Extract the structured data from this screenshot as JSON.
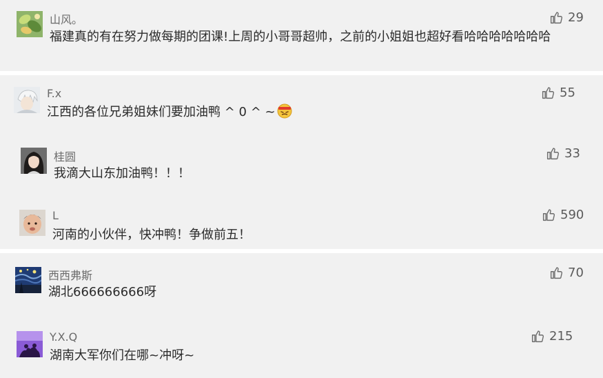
{
  "comments": [
    {
      "name": "山风。",
      "text": "福建真的有在努力做每期的团课!上周的小哥哥超帅，之前的小姐姐也超好看哈哈哈哈哈哈哈",
      "likes": "29",
      "avatar_icon": "green-leaves-avatar"
    },
    {
      "name": "F.x",
      "text": "江西的各位兄弟姐妹们要加油鸭 ^ 0 ^ ~",
      "likes": "55",
      "avatar_icon": "anime-character-avatar",
      "emoji_icon": "determined-face-emoji"
    },
    {
      "name": "桂圆",
      "text": "我滴大山东加油鸭！！！",
      "likes": "33",
      "avatar_icon": "girl-portrait-avatar"
    },
    {
      "name": "L",
      "text": "河南的小伙伴，快冲鸭！争做前五！",
      "likes": "590",
      "avatar_icon": "child-portrait-avatar"
    },
    {
      "name": "西西弗斯",
      "text": "湖北666666666呀",
      "likes": "70",
      "avatar_icon": "starry-night-avatar"
    },
    {
      "name": "Y.X.Q",
      "text": "湖南大军你们在哪~冲呀~",
      "likes": "215",
      "avatar_icon": "purple-silhouette-avatar"
    }
  ],
  "colors": {
    "background": "#f1f1f1",
    "name": "#6b6b6b",
    "text": "#2b2b2b",
    "like": "#5b5b5b"
  }
}
